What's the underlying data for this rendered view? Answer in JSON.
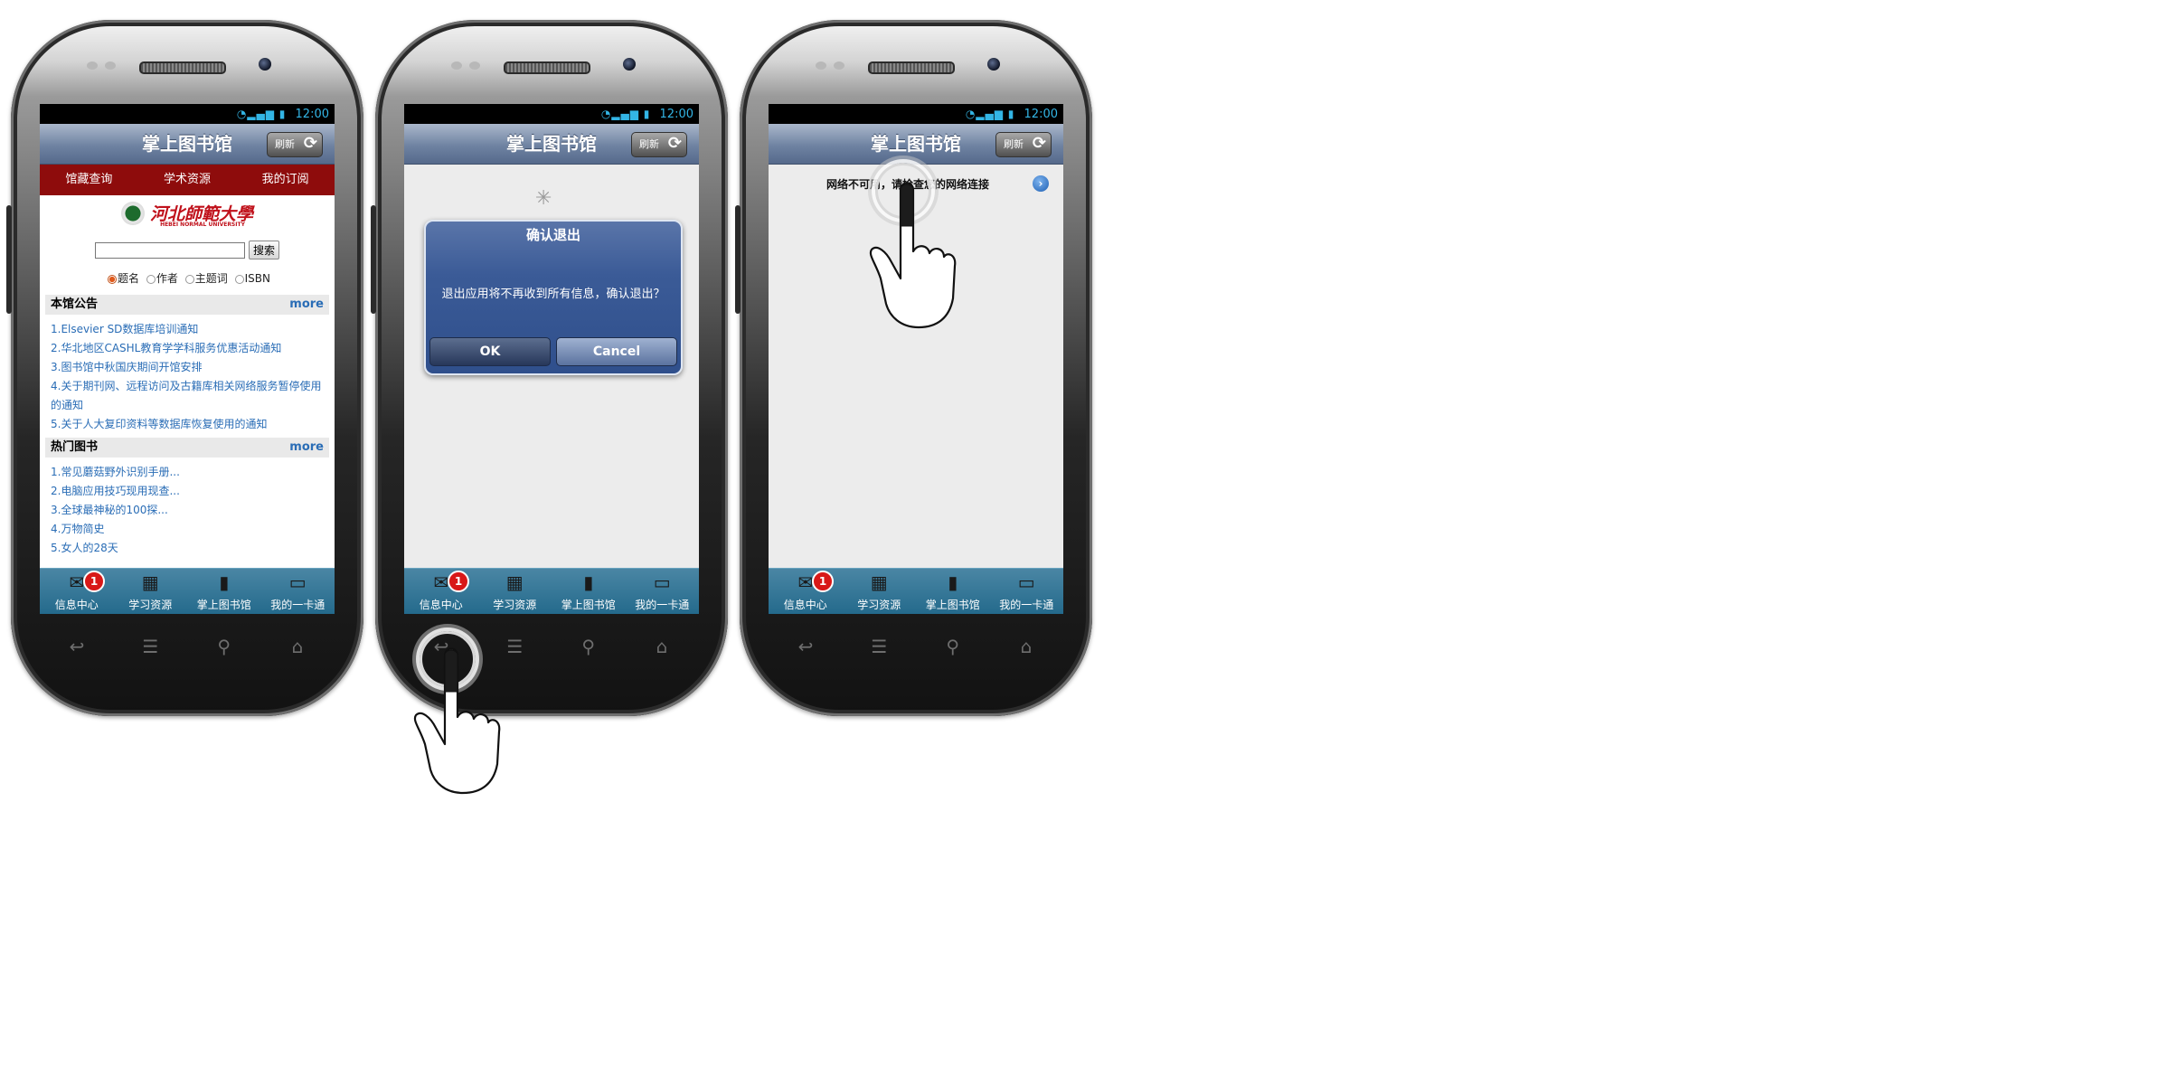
{
  "status": {
    "time": "12:00"
  },
  "app": {
    "title": "掌上图书馆",
    "refresh_label": "刷新"
  },
  "phone1": {
    "tabs": [
      "馆藏查询",
      "学术资源",
      "我的订阅"
    ],
    "logo_text": "河北師範大學",
    "logo_subtext": "HEBEI NORMAL UNIVERSITY",
    "search_button": "搜索",
    "search_value": "",
    "radio_options": [
      "题名",
      "作者",
      "主题词",
      "ISBN"
    ],
    "radio_selected": "题名",
    "announcements": {
      "title": "本馆公告",
      "more": "more",
      "items": [
        "1.Elsevier SD数据库培训通知",
        "2.华北地区CASHL教育学学科服务优惠活动通知",
        "3.图书馆中秋国庆期间开馆安排",
        "4.关于期刊网、远程访问及古籍库相关网络服务暂停使用的通知",
        "5.关于人大复印资料等数据库恢复使用的通知"
      ]
    },
    "hot_books": {
      "title": "热门图书",
      "more": "more",
      "items": [
        "1.常见蘑菇野外识别手册...",
        "2.电脑应用技巧现用现查...",
        "3.全球最神秘的100探...",
        "4.万物简史",
        "5.女人的28天"
      ]
    }
  },
  "phone2": {
    "dialog": {
      "title": "确认退出",
      "message": "退出应用将不再收到所有信息，确认退出？",
      "ok_label": "OK",
      "cancel_label": "Cancel"
    }
  },
  "phone3": {
    "network_message": "网络不可用，请检查您的网络连接"
  },
  "tabbar": {
    "badge_count": "1",
    "items": [
      "信息中心",
      "学习资源",
      "掌上图书馆",
      "我的一卡通"
    ],
    "icons": [
      "envelope-icon",
      "calendar-icon",
      "book-icon",
      "card-icon"
    ]
  },
  "hardware_keys": [
    "back-icon",
    "menu-icon",
    "search-icon",
    "home-icon"
  ],
  "colors": {
    "title_bar": "#6f83a2",
    "tab_red": "#8e0c0c",
    "tabbar_blue": "#246a8c",
    "link_blue": "#2a6db6",
    "badge_red": "#d81818",
    "dialog_blue": "#3b5b97"
  }
}
